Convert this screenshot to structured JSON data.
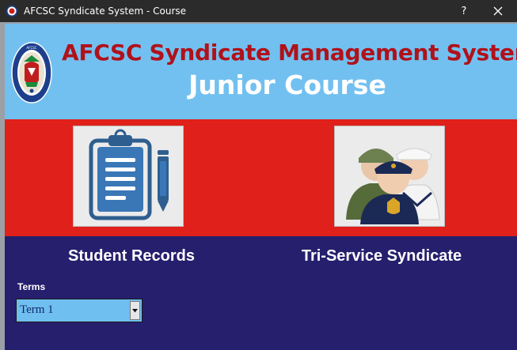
{
  "window": {
    "title": "AFCSC Syndicate System - Course",
    "help_label": "?"
  },
  "header": {
    "title": "AFCSC Syndicate Management System",
    "subtitle": "Junior Course",
    "crest_text": "ARMED FORCES COMMAND AND STAFF COLLEGE · JAJI · NIGERIA"
  },
  "tiles": [
    {
      "label": "Student Records",
      "icon": "clipboard-pencil-icon"
    },
    {
      "label": "Tri-Service Syndicate",
      "icon": "military-personnel-icon"
    }
  ],
  "terms": {
    "label": "Terms",
    "selected": "Term 1"
  },
  "colors": {
    "header_bg": "#72c0f0",
    "title_red": "#b0121a",
    "red_band": "#e0201a",
    "navy_band": "#261f6d",
    "select_bg": "#6fbff0"
  }
}
